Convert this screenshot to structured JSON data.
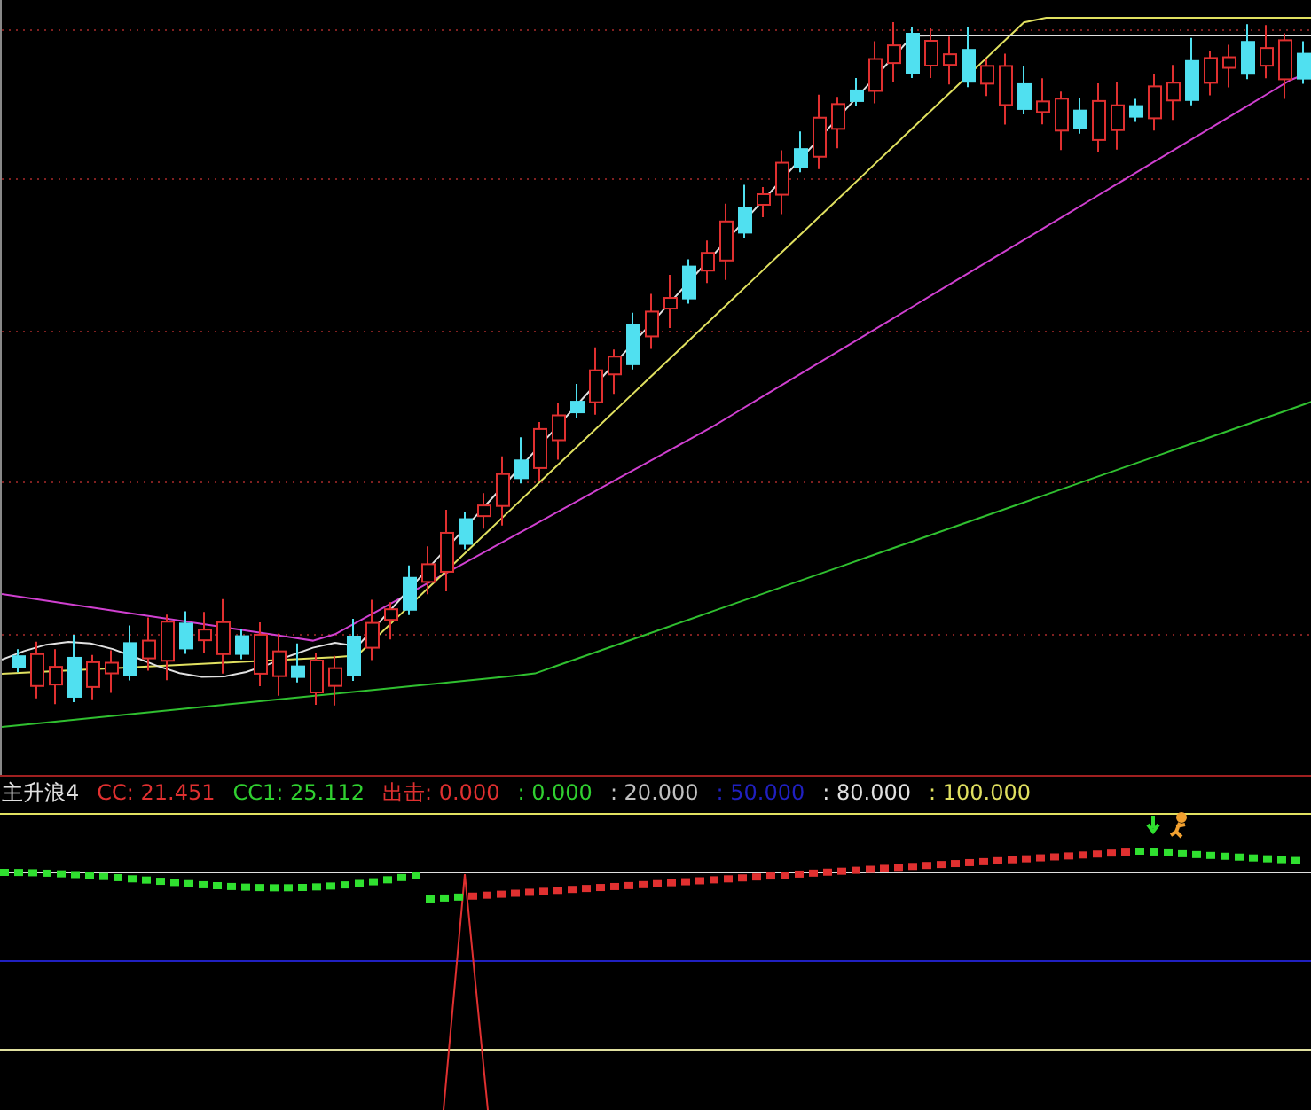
{
  "indicator_panel": {
    "name": "主升浪4",
    "legend": [
      {
        "text": "CC: 21.451",
        "color": "#e03030"
      },
      {
        "text": "CC1: 25.112",
        "color": "#30d030"
      },
      {
        "text": "出击: 0.000",
        "color": "#e03030"
      },
      {
        "text": ": 0.000",
        "color": "#30d030"
      },
      {
        "text": ": 20.000",
        "color": "#c0c0c0"
      },
      {
        "text": ": 50.000",
        "color": "#2020c0"
      },
      {
        "text": ": 80.000",
        "color": "#e0e0e0"
      },
      {
        "text": ": 100.000",
        "color": "#e0e060"
      }
    ]
  }
}
